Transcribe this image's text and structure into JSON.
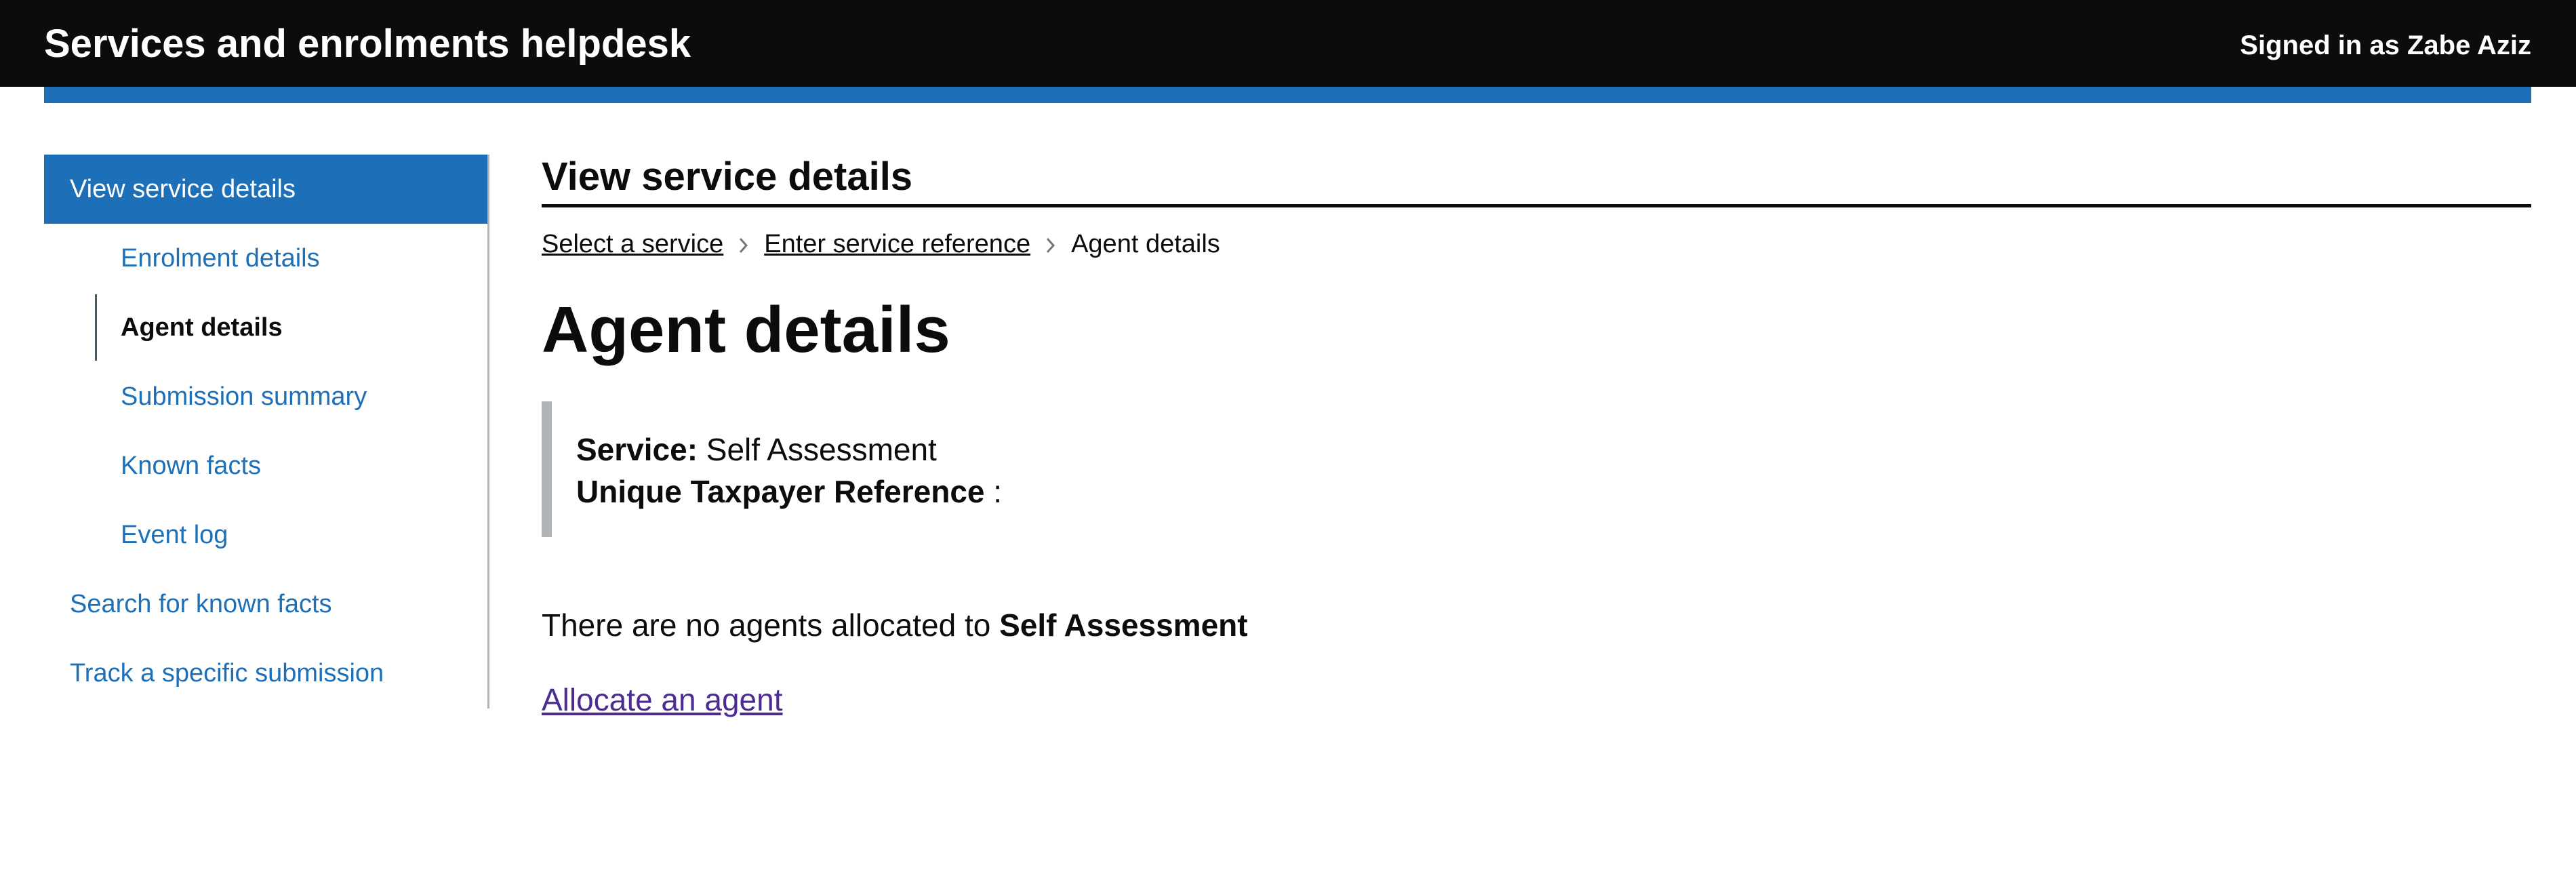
{
  "header": {
    "title": "Services and enrolments helpdesk",
    "user": "Signed in as Zabe Aziz"
  },
  "sidebar": {
    "items": [
      {
        "label": "View service details"
      },
      {
        "label": "Enrolment details"
      },
      {
        "label": "Agent details"
      },
      {
        "label": "Submission summary"
      },
      {
        "label": "Known facts"
      },
      {
        "label": "Event log"
      },
      {
        "label": "Search for known facts"
      },
      {
        "label": "Track a specific submission"
      }
    ]
  },
  "main": {
    "section_heading": "View service details",
    "breadcrumbs": [
      {
        "label": "Select a service"
      },
      {
        "label": "Enter service reference"
      },
      {
        "label": "Agent details"
      }
    ],
    "page_title": "Agent details",
    "inset": {
      "service_label": "Service:",
      "service_value": "Self Assessment",
      "utr_label": "Unique Taxpayer Reference",
      "utr_value": ":"
    },
    "no_agents_text": "There are no agents allocated to",
    "no_agents_service": "Self Assessment",
    "allocate_link": "Allocate an agent"
  },
  "colors": {
    "header_bg": "#0b0c0c",
    "accent_blue": "#1d70b8",
    "link_visited": "#4c2c92",
    "border_grey": "#b1b4b6"
  },
  "icons": {
    "breadcrumb_separator": "chevron-right-icon"
  }
}
